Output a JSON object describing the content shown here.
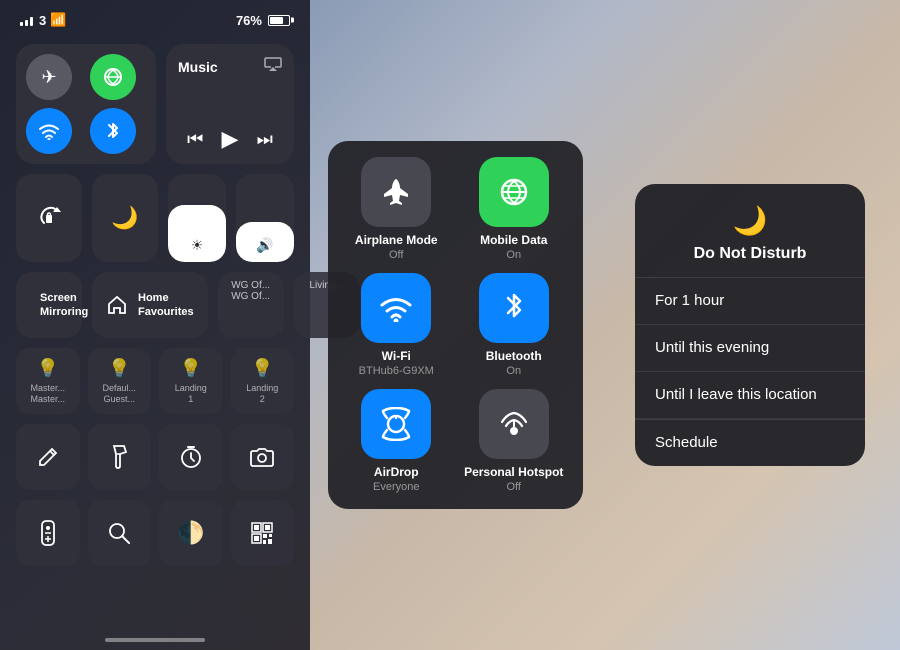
{
  "statusBar": {
    "carrier": "3",
    "signal": 3,
    "wifi": true,
    "time": "",
    "battery": "76%"
  },
  "connectivity": {
    "airplaneMode": {
      "label": "Airplane Mode",
      "sublabel": "Off",
      "active": false
    },
    "mobileData": {
      "label": "Mobile Data",
      "sublabel": "On",
      "active": true
    },
    "wifi": {
      "label": "Wi-Fi",
      "sublabel": "BTHub6-G9XM",
      "active": true
    },
    "bluetooth": {
      "label": "Bluetooth",
      "sublabel": "On",
      "active": true
    },
    "airdrop": {
      "label": "AirDrop",
      "sublabel": "Everyone",
      "active": true
    },
    "hotspot": {
      "label": "Personal Hotspot",
      "sublabel": "Off",
      "active": false
    }
  },
  "music": {
    "title": "Music",
    "airplayIcon": "⊙"
  },
  "controls": {
    "screenLock": "rotation-lock",
    "doNotDisturb": "moon",
    "screenMirror": {
      "icon": "▭▭",
      "label": "Screen\nMirroring"
    },
    "home": {
      "icon": "⌂",
      "label": "Home\nFavourites"
    },
    "homeItems": [
      "WG Of...\nWG Of...",
      "Living..."
    ]
  },
  "lights": [
    {
      "icon": "💡",
      "label": "Master...\nMaster..."
    },
    {
      "icon": "💡",
      "label": "Defaul...\nGuest..."
    },
    {
      "icon": "💡",
      "label": "Landing\n1"
    },
    {
      "icon": "💡",
      "label": "Landing\n2"
    }
  ],
  "bottomTools": [
    {
      "icon": "✏️",
      "name": "note-edit"
    },
    {
      "icon": "🔦",
      "name": "flashlight"
    },
    {
      "icon": "⏱",
      "name": "timer"
    },
    {
      "icon": "📷",
      "name": "camera"
    }
  ],
  "bottomTools2": [
    {
      "icon": "📺",
      "name": "remote"
    },
    {
      "icon": "🔍",
      "name": "magnifier"
    },
    {
      "icon": "🌓",
      "name": "dark-mode"
    },
    {
      "icon": "⬛",
      "name": "qr-scan"
    }
  ],
  "airdropExpanded": {
    "title": "AirDrop Everyone",
    "items": [
      {
        "icon": "✈",
        "label": "Airplane Mode",
        "sublabel": "Off",
        "type": "dark"
      },
      {
        "icon": "📶",
        "label": "Mobile Data",
        "sublabel": "On",
        "type": "green"
      },
      {
        "icon": "wifi",
        "label": "Wi-Fi",
        "sublabel": "BTHub6-G9XM",
        "type": "blue"
      },
      {
        "icon": "bluetooth",
        "label": "Bluetooth",
        "sublabel": "On",
        "type": "blue"
      },
      {
        "icon": "airdrop",
        "label": "AirDrop",
        "sublabel": "Everyone",
        "type": "blue"
      },
      {
        "icon": "hotspot",
        "label": "Personal Hotspot",
        "sublabel": "Off",
        "type": "gray"
      }
    ]
  },
  "doNotDisturb": {
    "icon": "🌙",
    "title": "Do Not Disturb",
    "options": [
      {
        "label": "For 1 hour"
      },
      {
        "label": "Until this evening"
      },
      {
        "label": "Until I leave this location"
      }
    ],
    "schedule": "Schedule"
  }
}
